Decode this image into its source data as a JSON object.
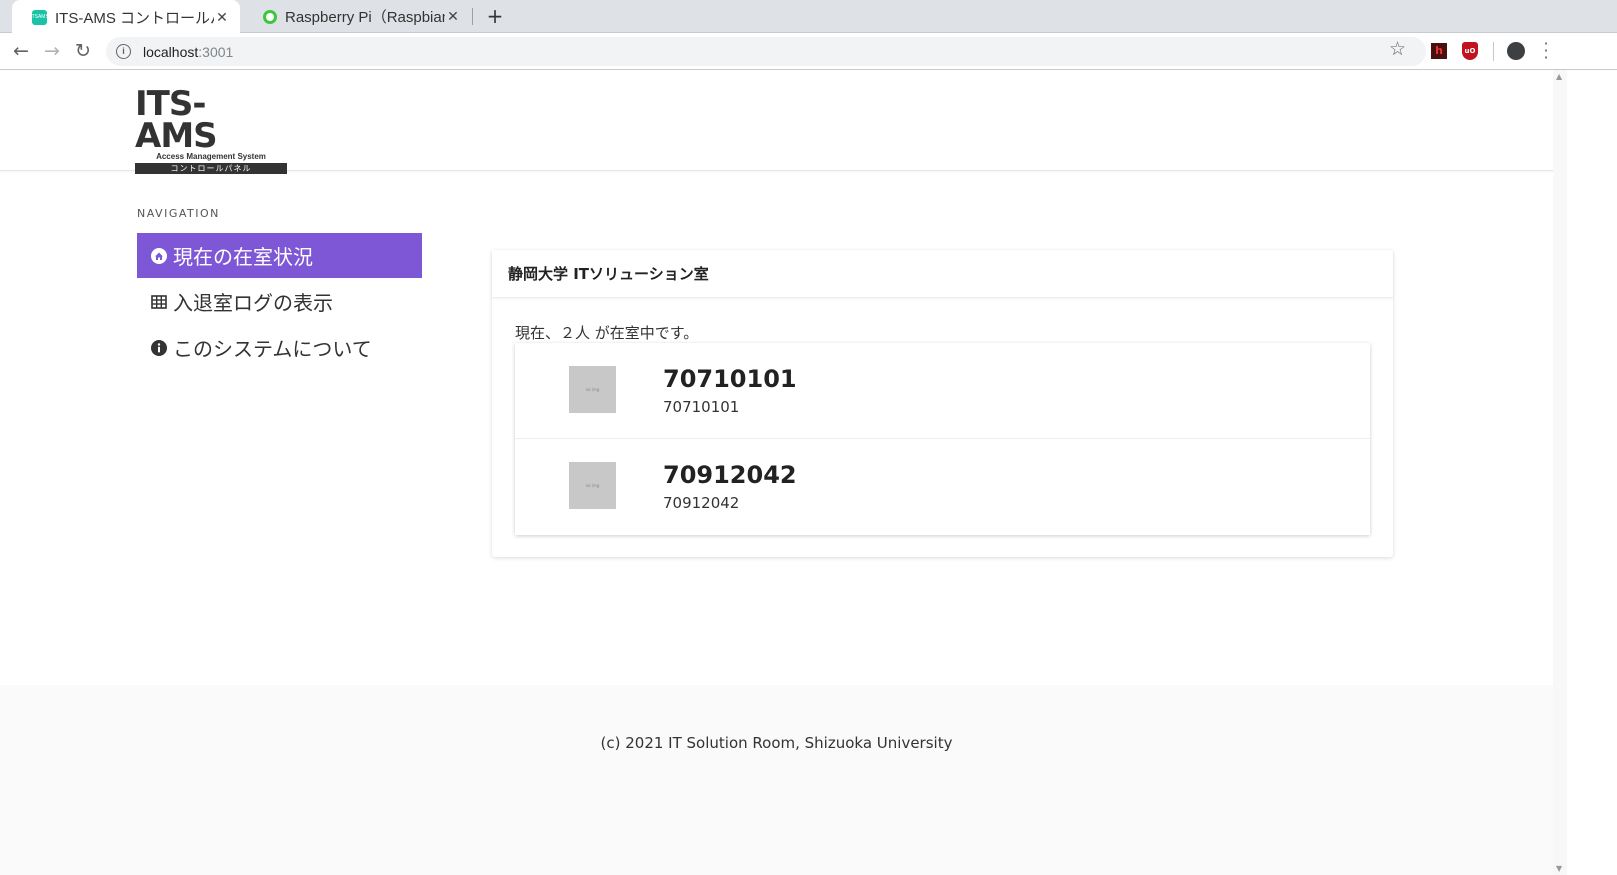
{
  "browser": {
    "tabs": [
      {
        "title": "ITS-AMS コントロールパネル",
        "favicon": "its-ams-favicon",
        "active": true
      },
      {
        "title": "Raspberry Pi（Raspbian",
        "favicon": "raspberry-favicon",
        "active": false
      }
    ],
    "url_host": "localhost",
    "url_port": ":3001"
  },
  "logo": {
    "main": "ITS-AMS",
    "sub": "Access Management System",
    "bar": "コントロールパネル"
  },
  "nav": {
    "title": "NAVIGATION",
    "items": [
      {
        "label": "現在の在室状況",
        "icon": "home-icon",
        "active": true
      },
      {
        "label": "入退室ログの表示",
        "icon": "table-icon",
        "active": false
      },
      {
        "label": "このシステムについて",
        "icon": "info-icon",
        "active": false
      }
    ]
  },
  "room": {
    "title": "静岡大学 ITソリューション室",
    "status": "現在、２人 が在室中です。",
    "members": [
      {
        "name": "70710101",
        "id": "70710101"
      },
      {
        "name": "70912042",
        "id": "70912042"
      }
    ]
  },
  "footer": {
    "copyright": "(c) 2021 IT Solution Room, Shizuoka University"
  },
  "colors": {
    "accent": "#7e57d6",
    "tabstrip": "#dee1e6",
    "footer": "#fafafa"
  }
}
